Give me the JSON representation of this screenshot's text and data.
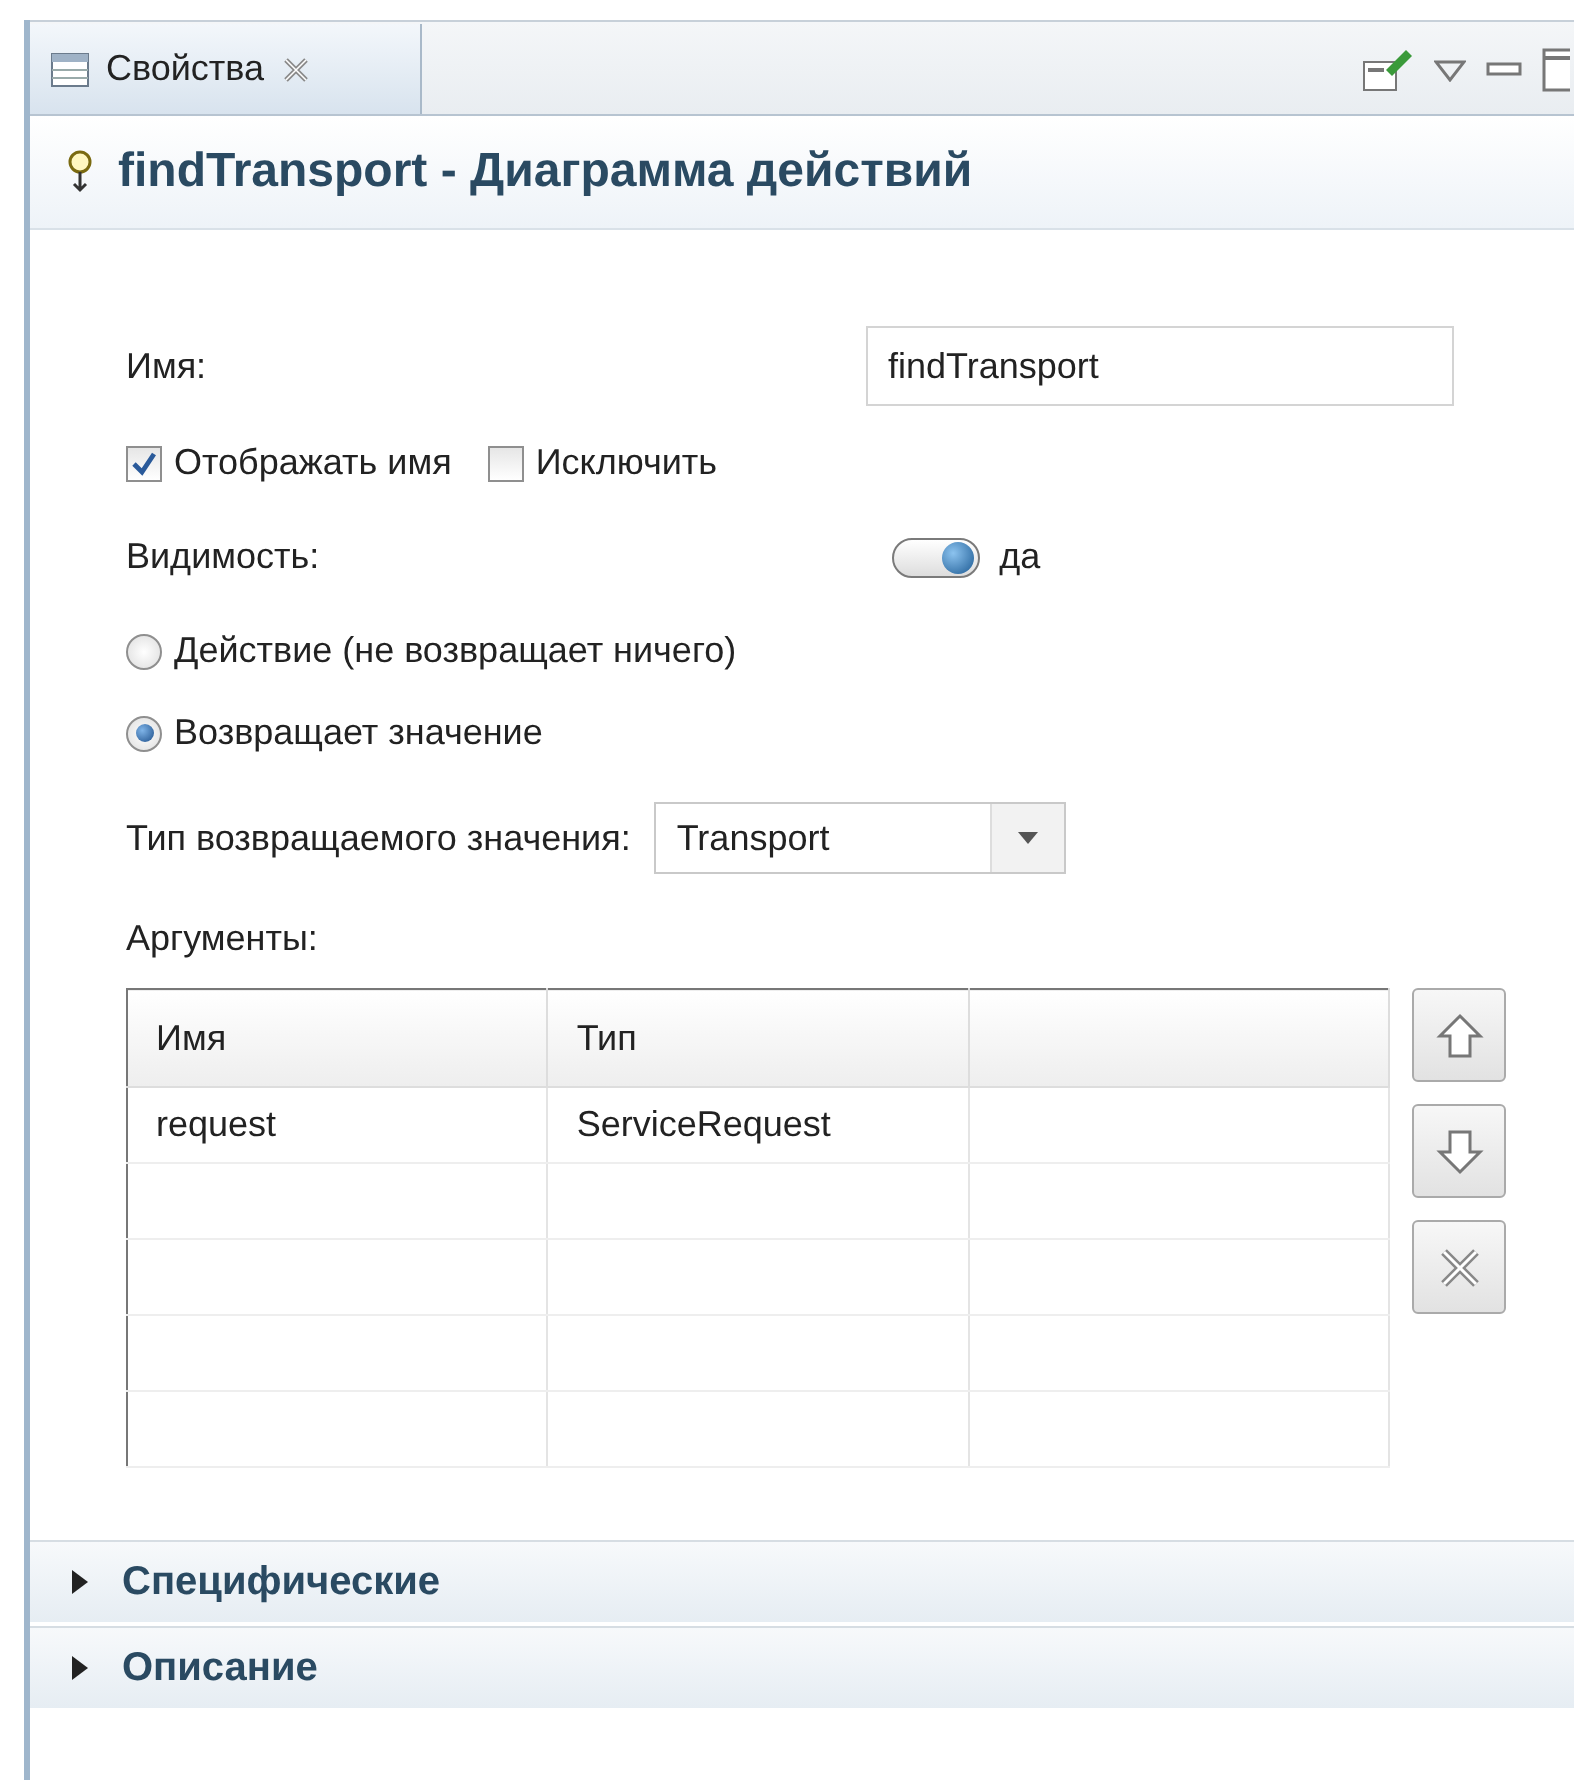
{
  "view_tab": {
    "label": "Свойства",
    "selected": true
  },
  "header": {
    "title": "findTransport - Диаграмма действий"
  },
  "name_field": {
    "label": "Имя:",
    "value": "findTransport"
  },
  "checkboxes": [
    {
      "label": "Отображать имя",
      "checked": true
    },
    {
      "label": "Исключить",
      "checked": false
    }
  ],
  "visibility": {
    "label": "Видимость:",
    "on": true,
    "value_label": "да"
  },
  "return_options": [
    {
      "label": "Действие (не возвращает ничего)",
      "selected": false
    },
    {
      "label": "Возвращает значение",
      "selected": true
    }
  ],
  "return_type": {
    "label": "Тип возвращаемого значения:",
    "value": "Transport"
  },
  "arguments": {
    "label": "Аргументы:",
    "columns": [
      "Имя",
      "Тип"
    ],
    "rows": [
      [
        "request",
        "ServiceRequest"
      ]
    ]
  },
  "sections": [
    {
      "label": "Специфические",
      "expanded": false
    },
    {
      "label": "Описание",
      "expanded": false
    }
  ]
}
